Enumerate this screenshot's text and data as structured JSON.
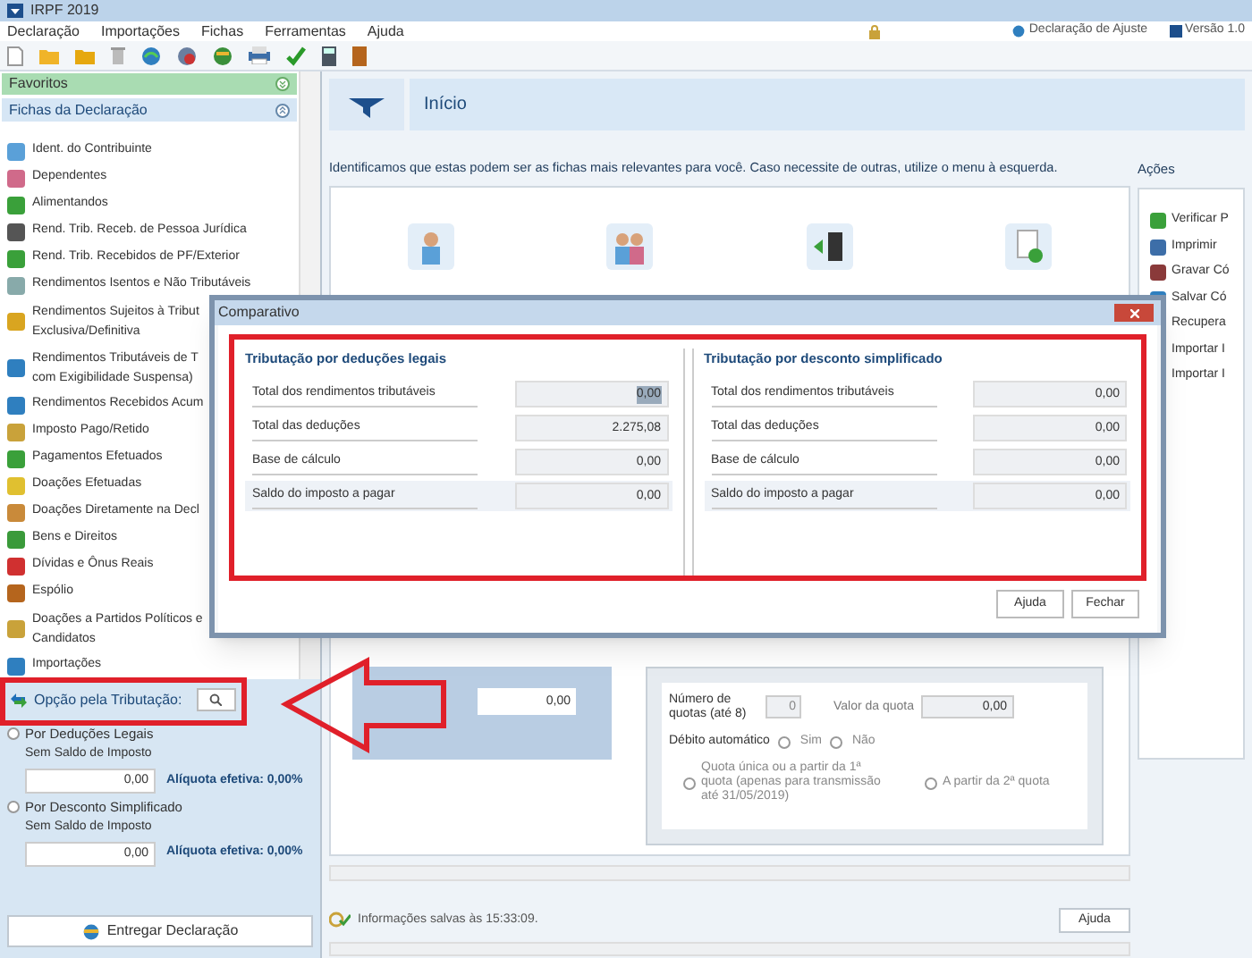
{
  "window": {
    "title": "IRPF 2019"
  },
  "menu": [
    "Declaração",
    "Importações",
    "Fichas",
    "Ferramentas",
    "Ajuda"
  ],
  "header_links": [
    "Declaração de Ajuste",
    "Versão 1.0"
  ],
  "sidebar": {
    "favorites": "Favoritos",
    "section": "Fichas da Declaração",
    "items": [
      {
        "label": "Ident. do Contribuinte"
      },
      {
        "label": "Dependentes"
      },
      {
        "label": "Alimentandos"
      },
      {
        "label": "Rend. Trib. Receb. de Pessoa Jurídica"
      },
      {
        "label": "Rend. Trib. Recebidos de PF/Exterior"
      },
      {
        "label": "Rendimentos Isentos e Não Tributáveis"
      },
      {
        "label": "Rendimentos Sujeitos à Tribut",
        "label_2": "Exclusiva/Definitiva"
      },
      {
        "label": "Rendimentos Tributáveis de T",
        "label_2": "com Exigibilidade Suspensa)"
      },
      {
        "label": "Rendimentos Recebidos Acum"
      },
      {
        "label": "Imposto Pago/Retido"
      },
      {
        "label": "Pagamentos Efetuados"
      },
      {
        "label": "Doações Efetuadas"
      },
      {
        "label": "Doações Diretamente na Decl"
      },
      {
        "label": "Bens e Direitos"
      },
      {
        "label": "Dívidas e Ônus Reais"
      },
      {
        "label": "Espólio"
      },
      {
        "label": "Doações a Partidos Políticos e",
        "label_2": "Candidatos"
      },
      {
        "label": "Importações"
      }
    ]
  },
  "tax_option": {
    "label": "Opção pela Tributação:",
    "options": [
      {
        "label": "Por Deduções Legais",
        "selected": false,
        "status": "Sem Saldo de Imposto",
        "value": "0,00",
        "rate": "Alíquota efetiva: 0,00%"
      },
      {
        "label": "Por Desconto Simplificado",
        "selected": false,
        "status": "Sem Saldo de Imposto",
        "value": "0,00",
        "rate": "Alíquota efetiva: 0,00%"
      }
    ]
  },
  "deliver_button": "Entregar Declaração",
  "main": {
    "title": "Início",
    "intro": "Identificamos que estas podem ser as fichas mais relevantes para você. Caso necessite de outras, utilize o menu à esquerda.",
    "actions_title": "Ações",
    "actions": [
      "Verificar P",
      "Imprimir",
      "Gravar Có",
      "Salvar Có",
      "Recupera",
      "Importar I",
      "Importar I"
    ]
  },
  "summary_value": "0,00",
  "payment": {
    "quotas_label": "Número de quotas (até 8)",
    "quotas": "0",
    "quota_value_label": "Valor da quota",
    "quota_value": "0,00",
    "debit_label": "Débito automático",
    "debit_options": [
      {
        "label": "Sim",
        "selected": false
      },
      {
        "label": "Não",
        "selected": false
      }
    ],
    "start_options": [
      {
        "label": "Quota única ou a partir da 1ª quota (apenas para transmissão até 31/05/2019)",
        "selected": false
      },
      {
        "label": "A partir da 2ª quota",
        "selected": false
      }
    ]
  },
  "status_bar": {
    "text": "Informações salvas às 15:33:09.",
    "help_button": "Ajuda"
  },
  "dialog": {
    "title": "Comparativo",
    "sections": [
      {
        "title": "Tributação por deduções legais",
        "rows": [
          {
            "label": "Total dos rendimentos tributáveis",
            "value": "0,00",
            "selected": true
          },
          {
            "label": "Total das deduções",
            "value": "2.275,08",
            "selected": false
          },
          {
            "label": "Base de cálculo",
            "value": "0,00",
            "selected": false
          },
          {
            "label": "Saldo do imposto a pagar",
            "value": "0,00",
            "selected": false
          }
        ]
      },
      {
        "title": "Tributação por desconto simplificado",
        "rows": [
          {
            "label": "Total dos rendimentos tributáveis",
            "value": "0,00",
            "selected": false
          },
          {
            "label": "Total das deduções",
            "value": "0,00",
            "selected": false
          },
          {
            "label": "Base de cálculo",
            "value": "0,00",
            "selected": false
          },
          {
            "label": "Saldo do imposto a pagar",
            "value": "0,00",
            "selected": false
          }
        ]
      }
    ],
    "buttons": [
      "Ajuda",
      "Fechar"
    ]
  }
}
